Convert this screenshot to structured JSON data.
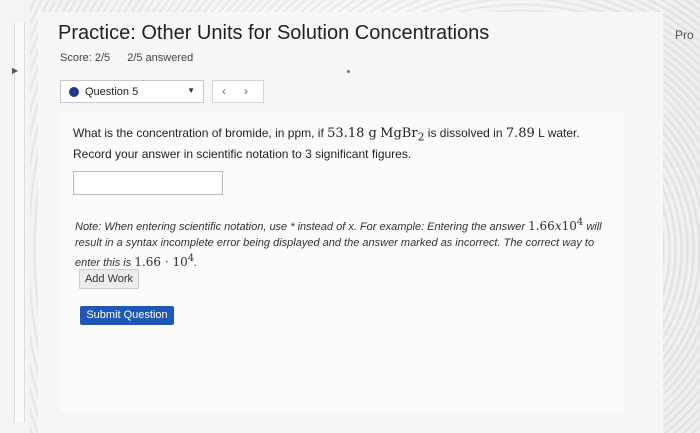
{
  "header": {
    "title": "Practice: Other Units for Solution Concentrations",
    "score": "Score: 2/5",
    "answered": "2/5 answered",
    "corner_text": "Pro"
  },
  "question_nav": {
    "selected": "Question 5",
    "prev_icon": "chevron-left-icon",
    "next_icon": "chevron-right-icon"
  },
  "question": {
    "text_before": "What is the concentration of bromide, in ppm, if",
    "mass": "53.18 g",
    "formula": "MgBr",
    "formula_sub": "2",
    "text_middle": "is dissolved in",
    "volume": "7.89",
    "text_after": "L water. Record your answer in scientific notation to 3 significant figures."
  },
  "answer": {
    "value": ""
  },
  "note": {
    "part1": "Note: When entering scientific notation, use * instead of x. For example: Entering the answer",
    "example1_base": "1.66",
    "example1_x": "x",
    "example1_pow": "10",
    "example1_exp": "4",
    "part2": "will result in a syntax incomplete error being displayed and the answer marked as incorrect. The correct way to enter this is",
    "example2_base": "1.66 · 10",
    "example2_exp": "4",
    "end": "."
  },
  "buttons": {
    "add_work": "Add Work",
    "submit": "Submit Question"
  },
  "colors": {
    "accent": "#1f57b8",
    "dot": "#1f3a8a"
  }
}
